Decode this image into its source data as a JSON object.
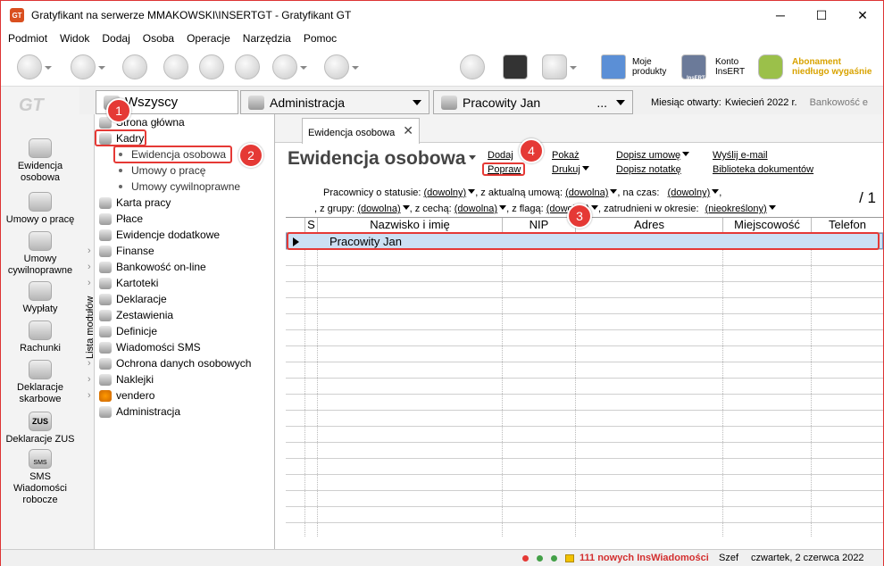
{
  "window": {
    "title": "Gratyfikant na serwerze MMAKOWSKI\\INSERTGT - Gratyfikant GT",
    "app_icon": "GT",
    "controls": [
      "─",
      "☐",
      "✕"
    ]
  },
  "menu": [
    "Podmiot",
    "Widok",
    "Dodaj",
    "Osoba",
    "Operacje",
    "Narzędzia",
    "Pomoc"
  ],
  "toolbar": {
    "moje_produkty": "Moje\nprodukty",
    "konto": "Konto\nInsERT",
    "insert_badge": "InsERT",
    "abonament": "Abonament\nniedługo wygaśnie"
  },
  "leftnav": {
    "logo": "GT",
    "items": [
      "Ewidencja\nosobowa",
      "Umowy o pracę",
      "Umowy\ncywilnoprawne",
      "Wypłaty",
      "Rachunki",
      "Deklaracje\nskarbowe",
      "Deklaracje ZUS",
      "SMS\nWiadomości\nrobocze"
    ],
    "zus_icon_text": "ZUS",
    "sms_icon_text": "SMS"
  },
  "tabs": {
    "group": "Wszyscy",
    "group2": "Administracja",
    "employee": "Pracowity Jan",
    "employee_more": "...",
    "month_label": "Miesiąc otwarty:",
    "month_value": "Kwiecień 2022 r.",
    "bank": "Bankowość e"
  },
  "side_label": "Lista modułów",
  "tree": {
    "items": [
      "Strona główna",
      "Kadry",
      "Karta pracy",
      "Płace",
      "Ewidencje dodatkowe",
      "Finanse",
      "Bankowość on-line",
      "Kartoteki",
      "Deklaracje",
      "Zestawienia",
      "Definicje",
      "Wiadomości SMS",
      "Ochrona danych osobowych",
      "Naklejki",
      "vendero",
      "Administracja"
    ],
    "sub": [
      "Ewidencja osobowa",
      "Umowy o pracę",
      "Umowy cywilnoprawne"
    ]
  },
  "content": {
    "tab": "Ewidencja osobowa",
    "close": "✕",
    "heading": "Ewidencja osobowa",
    "links": {
      "dodaj": "Dodaj",
      "popraw": "Popraw",
      "pokaz": "Pokaż",
      "drukuj": "Drukuj",
      "dopisz_umowe": "Dopisz umowę",
      "dopisz_notatke": "Dopisz notatkę",
      "wyslij": "Wyślij e-mail",
      "biblioteka": "Biblioteka dokumentów"
    },
    "filters": {
      "l1a": "Pracownicy o statusie:",
      "v1a": "(dowolny)",
      "l1b": ", z aktualną umową:",
      "v1b": "(dowolna)",
      "l1c": ", na czas:",
      "v1c": "(dowolny)",
      "l1d": ",",
      "l2a": ", z grupy:",
      "v2a": "(dowolna)",
      "l2b": ", z cechą:",
      "v2b": "(dowolna)",
      "l2c": ", z flagą:",
      "v2c": "(dowolna)",
      "l2d": ", zatrudnieni w okresie:",
      "v2d": "(nieokreślony)"
    },
    "page": "/ 1",
    "columns": [
      "S",
      "Nazwisko i imię",
      "NIP",
      "Adres",
      "Miejscowość",
      "Telefon"
    ],
    "rows": [
      {
        "name": "Pracowity Jan"
      }
    ]
  },
  "status": {
    "msgs": "111 nowych InsWiadomości",
    "szef": "Szef",
    "date": "czwartek, 2 czerwca 2022",
    "led_colors": [
      "#e53935",
      "#43a047",
      "#43a047"
    ]
  },
  "annotations": [
    "1",
    "2",
    "3",
    "4"
  ]
}
